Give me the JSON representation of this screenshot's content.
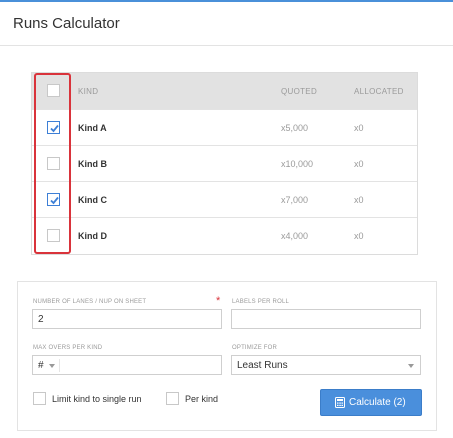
{
  "header": {
    "title": "Runs Calculator"
  },
  "table": {
    "columns": {
      "kind": "KIND",
      "quoted": "QUOTED",
      "allocated": "ALLOCATED"
    },
    "select_all_checked": false,
    "rows": [
      {
        "kind": "Kind A",
        "quoted": "x5,000",
        "allocated": "x0",
        "checked": true
      },
      {
        "kind": "Kind B",
        "quoted": "x10,000",
        "allocated": "x0",
        "checked": false
      },
      {
        "kind": "Kind C",
        "quoted": "x7,000",
        "allocated": "x0",
        "checked": true
      },
      {
        "kind": "Kind D",
        "quoted": "x4,000",
        "allocated": "x0",
        "checked": false
      }
    ]
  },
  "form": {
    "lanes": {
      "label": "NUMBER OF LANES / NUP ON SHEET",
      "value": "2",
      "required_mark": "*"
    },
    "labels_per_roll": {
      "label": "LABELS PER ROLL",
      "value": ""
    },
    "max_overs": {
      "label": "MAX OVERS PER KIND",
      "unit": "#",
      "value": ""
    },
    "optimize_for": {
      "label": "OPTIMIZE FOR",
      "value": "Least Runs"
    },
    "limit_single_run": {
      "label": "Limit kind to single run",
      "checked": false
    },
    "per_kind": {
      "label": "Per kind",
      "checked": false
    },
    "calculate_button": {
      "label": "Calculate (2)"
    }
  },
  "colors": {
    "accent": "#4a8fdc",
    "highlight": "#d9333b",
    "header_bg": "#e2e2e2"
  }
}
